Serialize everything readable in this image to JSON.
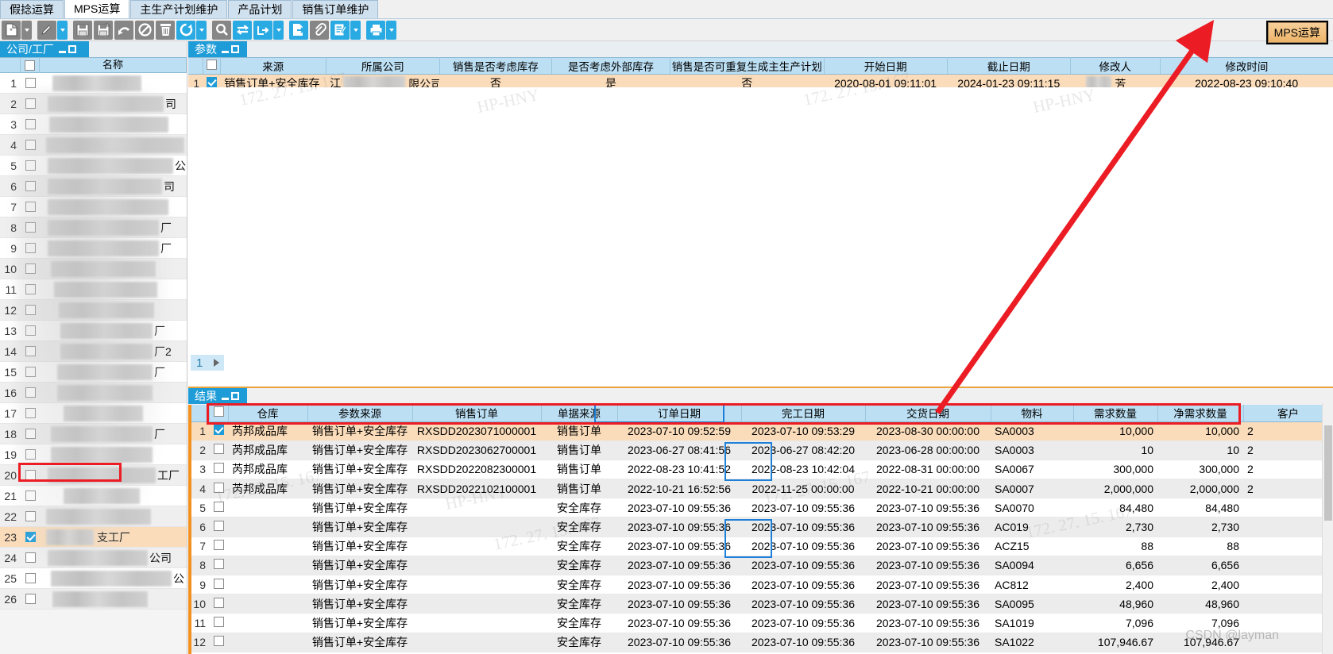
{
  "tabs": [
    {
      "label": "假捻运算",
      "active": false
    },
    {
      "label": "MPS运算",
      "active": true
    },
    {
      "label": "主生产计划维护",
      "active": false
    },
    {
      "label": "产品计划",
      "active": false
    },
    {
      "label": "销售订单维护",
      "active": false
    }
  ],
  "toolbar": {
    "buttons": [
      {
        "name": "new-icon",
        "style": "grey",
        "caret": true
      },
      {
        "name": "edit-icon",
        "style": "grey",
        "caret": true,
        "caret_style": "blue"
      },
      {
        "name": "save-icon",
        "style": "grey",
        "caret": false
      },
      {
        "name": "save-as-icon",
        "style": "grey",
        "caret": false
      },
      {
        "name": "undo-icon",
        "style": "grey",
        "caret": false
      },
      {
        "name": "cancel-icon",
        "style": "grey",
        "caret": false
      },
      {
        "name": "delete-icon",
        "style": "grey",
        "caret": false
      },
      {
        "name": "refresh-icon",
        "style": "blue",
        "caret": true,
        "caret_style": "blue"
      },
      {
        "name": "search-icon",
        "style": "grey",
        "caret": false
      },
      {
        "name": "exchange-icon",
        "style": "blue",
        "caret": false
      },
      {
        "name": "import-icon",
        "style": "blue",
        "caret": true,
        "caret_style": "blue"
      },
      {
        "name": "export-icon",
        "style": "blue",
        "caret": false
      },
      {
        "name": "attachment-icon",
        "style": "grey",
        "caret": false
      },
      {
        "name": "report-icon",
        "style": "blue",
        "caret": true,
        "caret_style": "blue"
      },
      {
        "name": "print-icon",
        "style": "blue",
        "caret": true,
        "caret_style": "blue"
      }
    ]
  },
  "mps_run_button": {
    "label": "MPS运算"
  },
  "left_panel": {
    "caption": "公司/工厂",
    "columns": [
      "",
      "",
      "名称"
    ],
    "name_header": "名称",
    "rows": [
      {
        "num": "1",
        "checked": false,
        "redactions": [
          [
            16,
            112
          ]
        ],
        "tail": ""
      },
      {
        "num": "2",
        "checked": false,
        "redactions": [
          [
            10,
            146
          ]
        ],
        "tail": "司"
      },
      {
        "num": "3",
        "checked": false,
        "redactions": [
          [
            12,
            150
          ]
        ],
        "tail": ""
      },
      {
        "num": "4",
        "checked": false,
        "redactions": [
          [
            8,
            174
          ]
        ],
        "tail": ""
      },
      {
        "num": "5",
        "checked": false,
        "redactions": [
          [
            10,
            158
          ]
        ],
        "tail": "公司"
      },
      {
        "num": "6",
        "checked": false,
        "redactions": [
          [
            10,
            144
          ]
        ],
        "tail": "司"
      },
      {
        "num": "7",
        "checked": false,
        "redactions": [
          [
            10,
            152
          ]
        ],
        "tail": ""
      },
      {
        "num": "8",
        "checked": false,
        "redactions": [
          [
            10,
            140
          ]
        ],
        "tail": "厂"
      },
      {
        "num": "9",
        "checked": false,
        "redactions": [
          [
            10,
            140
          ]
        ],
        "tail": "厂"
      },
      {
        "num": "10",
        "checked": false,
        "redactions": [
          [
            14,
            132
          ]
        ],
        "tail": ""
      },
      {
        "num": "11",
        "checked": false,
        "redactions": [
          [
            18,
            130
          ]
        ],
        "tail": ""
      },
      {
        "num": "12",
        "checked": false,
        "redactions": [
          [
            24,
            120
          ]
        ],
        "tail": ""
      },
      {
        "num": "13",
        "checked": false,
        "redactions": [
          [
            26,
            116
          ]
        ],
        "tail": "厂"
      },
      {
        "num": "14",
        "checked": false,
        "redactions": [
          [
            26,
            116
          ]
        ],
        "tail": "厂2"
      },
      {
        "num": "15",
        "checked": false,
        "redactions": [
          [
            22,
            120
          ]
        ],
        "tail": "厂"
      },
      {
        "num": "16",
        "checked": false,
        "redactions": [
          [
            22,
            120
          ]
        ],
        "tail": ""
      },
      {
        "num": "17",
        "checked": false,
        "redactions": [
          [
            30,
            100
          ]
        ],
        "tail": ""
      },
      {
        "num": "18",
        "checked": false,
        "redactions": [
          [
            14,
            128
          ]
        ],
        "tail": "厂"
      },
      {
        "num": "19",
        "checked": false,
        "redactions": [
          [
            14,
            128
          ]
        ],
        "tail": ""
      },
      {
        "num": "20",
        "checked": false,
        "redactions": [
          [
            10,
            136
          ]
        ],
        "tail": "工厂"
      },
      {
        "num": "21",
        "checked": false,
        "redactions": [
          [
            30,
            96
          ]
        ],
        "tail": ""
      },
      {
        "num": "22",
        "checked": false,
        "redactions": [
          [
            8,
            132
          ]
        ],
        "tail": ""
      },
      {
        "num": "23",
        "checked": true,
        "redactions": [
          [
            8,
            60
          ]
        ],
        "tail": "支工厂",
        "selected": true
      },
      {
        "num": "24",
        "checked": false,
        "redactions": [
          [
            10,
            126
          ]
        ],
        "tail": "公司"
      },
      {
        "num": "25",
        "checked": false,
        "redactions": [
          [
            14,
            152
          ]
        ],
        "tail": "公司"
      },
      {
        "num": "26",
        "checked": false,
        "redactions": [
          [
            16,
            120
          ]
        ],
        "tail": ""
      }
    ]
  },
  "param_panel": {
    "caption": "参数",
    "columns": [
      "来源",
      "所属公司",
      "销售是否考虑库存",
      "是否考虑外部库存",
      "销售是否可重复生成主生产计划",
      "开始日期",
      "截止日期",
      "修改人",
      "修改时间"
    ],
    "rows": [
      {
        "num": "1",
        "checked": true,
        "source": "销售订单+安全库存",
        "company_prefix": "江",
        "company_suffix": "限公司",
        "sales_consider_stock": "否",
        "consider_external_stock": "是",
        "repeat_generate_mps": "否",
        "start_date": "2020-08-01 09:11:01",
        "end_date": "2024-01-23 09:11:15",
        "modifier": "芳",
        "modify_time": "2022-08-23 09:10:40"
      }
    ],
    "pager": {
      "page": "1"
    }
  },
  "result_panel": {
    "caption": "结果",
    "columns": [
      "仓库",
      "参数来源",
      "销售订单",
      "单据来源",
      "订单日期",
      "完工日期",
      "交货日期",
      "物料",
      "需求数量",
      "净需求数量",
      "客户"
    ],
    "rows": [
      {
        "num": "1",
        "checked": true,
        "warehouse": "芮邦成品库",
        "param_source": "销售订单+安全库存",
        "sales_order": "RXSDD2023071000001",
        "doc_source": "销售订单",
        "order_date": "2023-07-10 09:52:59",
        "finish_date": "2023-07-10 09:53:29",
        "delivery_date": "2023-08-30 00:00:00",
        "material": "SA0003",
        "demand_qty": "10,000",
        "net_demand_qty": "10,000",
        "customer": "2",
        "highlight": true
      },
      {
        "num": "2",
        "checked": false,
        "warehouse": "芮邦成品库",
        "param_source": "销售订单+安全库存",
        "sales_order": "RXSDD2023062700001",
        "doc_source": "销售订单",
        "order_date": "2023-06-27 08:41:56",
        "finish_date": "2023-06-27 08:42:20",
        "delivery_date": "2023-06-28 00:00:00",
        "material": "SA0003",
        "demand_qty": "10",
        "net_demand_qty": "10",
        "customer": "2"
      },
      {
        "num": "3",
        "checked": false,
        "warehouse": "芮邦成品库",
        "param_source": "销售订单+安全库存",
        "sales_order": "RXSDD2022082300001",
        "doc_source": "销售订单",
        "order_date": "2022-08-23 10:41:52",
        "finish_date": "2022-08-23 10:42:04",
        "delivery_date": "2022-08-31 00:00:00",
        "material": "SA0067",
        "demand_qty": "300,000",
        "net_demand_qty": "300,000",
        "customer": "2"
      },
      {
        "num": "4",
        "checked": false,
        "warehouse": "芮邦成品库",
        "param_source": "销售订单+安全库存",
        "sales_order": "RXSDD2022102100001",
        "doc_source": "销售订单",
        "order_date": "2022-10-21 16:52:56",
        "finish_date": "2022-11-25 00:00:00",
        "delivery_date": "2022-10-21 00:00:00",
        "material": "SA0007",
        "demand_qty": "2,000,000",
        "net_demand_qty": "2,000,000",
        "customer": "2"
      },
      {
        "num": "5",
        "checked": false,
        "warehouse": "",
        "param_source": "销售订单+安全库存",
        "sales_order": "",
        "doc_source": "安全库存",
        "order_date": "2023-07-10 09:55:36",
        "finish_date": "2023-07-10 09:55:36",
        "delivery_date": "2023-07-10 09:55:36",
        "material": "SA0070",
        "demand_qty": "84,480",
        "net_demand_qty": "84,480",
        "customer": ""
      },
      {
        "num": "6",
        "checked": false,
        "warehouse": "",
        "param_source": "销售订单+安全库存",
        "sales_order": "",
        "doc_source": "安全库存",
        "order_date": "2023-07-10 09:55:36",
        "finish_date": "2023-07-10 09:55:36",
        "delivery_date": "2023-07-10 09:55:36",
        "material": "AC019",
        "demand_qty": "2,730",
        "net_demand_qty": "2,730",
        "customer": ""
      },
      {
        "num": "7",
        "checked": false,
        "warehouse": "",
        "param_source": "销售订单+安全库存",
        "sales_order": "",
        "doc_source": "安全库存",
        "order_date": "2023-07-10 09:55:36",
        "finish_date": "2023-07-10 09:55:36",
        "delivery_date": "2023-07-10 09:55:36",
        "material": "ACZ15",
        "demand_qty": "88",
        "net_demand_qty": "88",
        "customer": ""
      },
      {
        "num": "8",
        "checked": false,
        "warehouse": "",
        "param_source": "销售订单+安全库存",
        "sales_order": "",
        "doc_source": "安全库存",
        "order_date": "2023-07-10 09:55:36",
        "finish_date": "2023-07-10 09:55:36",
        "delivery_date": "2023-07-10 09:55:36",
        "material": "SA0094",
        "demand_qty": "6,656",
        "net_demand_qty": "6,656",
        "customer": ""
      },
      {
        "num": "9",
        "checked": false,
        "warehouse": "",
        "param_source": "销售订单+安全库存",
        "sales_order": "",
        "doc_source": "安全库存",
        "order_date": "2023-07-10 09:55:36",
        "finish_date": "2023-07-10 09:55:36",
        "delivery_date": "2023-07-10 09:55:36",
        "material": "AC812",
        "demand_qty": "2,400",
        "net_demand_qty": "2,400",
        "customer": ""
      },
      {
        "num": "10",
        "checked": false,
        "warehouse": "",
        "param_source": "销售订单+安全库存",
        "sales_order": "",
        "doc_source": "安全库存",
        "order_date": "2023-07-10 09:55:36",
        "finish_date": "2023-07-10 09:55:36",
        "delivery_date": "2023-07-10 09:55:36",
        "material": "SA0095",
        "demand_qty": "48,960",
        "net_demand_qty": "48,960",
        "customer": ""
      },
      {
        "num": "11",
        "checked": false,
        "warehouse": "",
        "param_source": "销售订单+安全库存",
        "sales_order": "",
        "doc_source": "安全库存",
        "order_date": "2023-07-10 09:55:36",
        "finish_date": "2023-07-10 09:55:36",
        "delivery_date": "2023-07-10 09:55:36",
        "material": "SA1019",
        "demand_qty": "7,096",
        "net_demand_qty": "7,096",
        "customer": ""
      },
      {
        "num": "12",
        "checked": false,
        "warehouse": "",
        "param_source": "销售订单+安全库存",
        "sales_order": "",
        "doc_source": "安全库存",
        "order_date": "2023-07-10 09:55:36",
        "finish_date": "2023-07-10 09:55:36",
        "delivery_date": "2023-07-10 09:55:36",
        "material": "SA1022",
        "demand_qty": "107,946.67",
        "net_demand_qty": "107,946.67",
        "customer": ""
      }
    ]
  },
  "watermarks": {
    "ip": "172. 27. 15. 167",
    "host": "HP-HNY",
    "credit": "CSDN @layman"
  },
  "colors": {
    "accent_blue": "#1e9cd7",
    "header_blue": "#bcdff4",
    "highlight_orange": "#fbdcba",
    "annotation_red": "#ec1c24",
    "outline_blue": "#1e7fd6",
    "panel_bar_orange": "#f2911f"
  }
}
